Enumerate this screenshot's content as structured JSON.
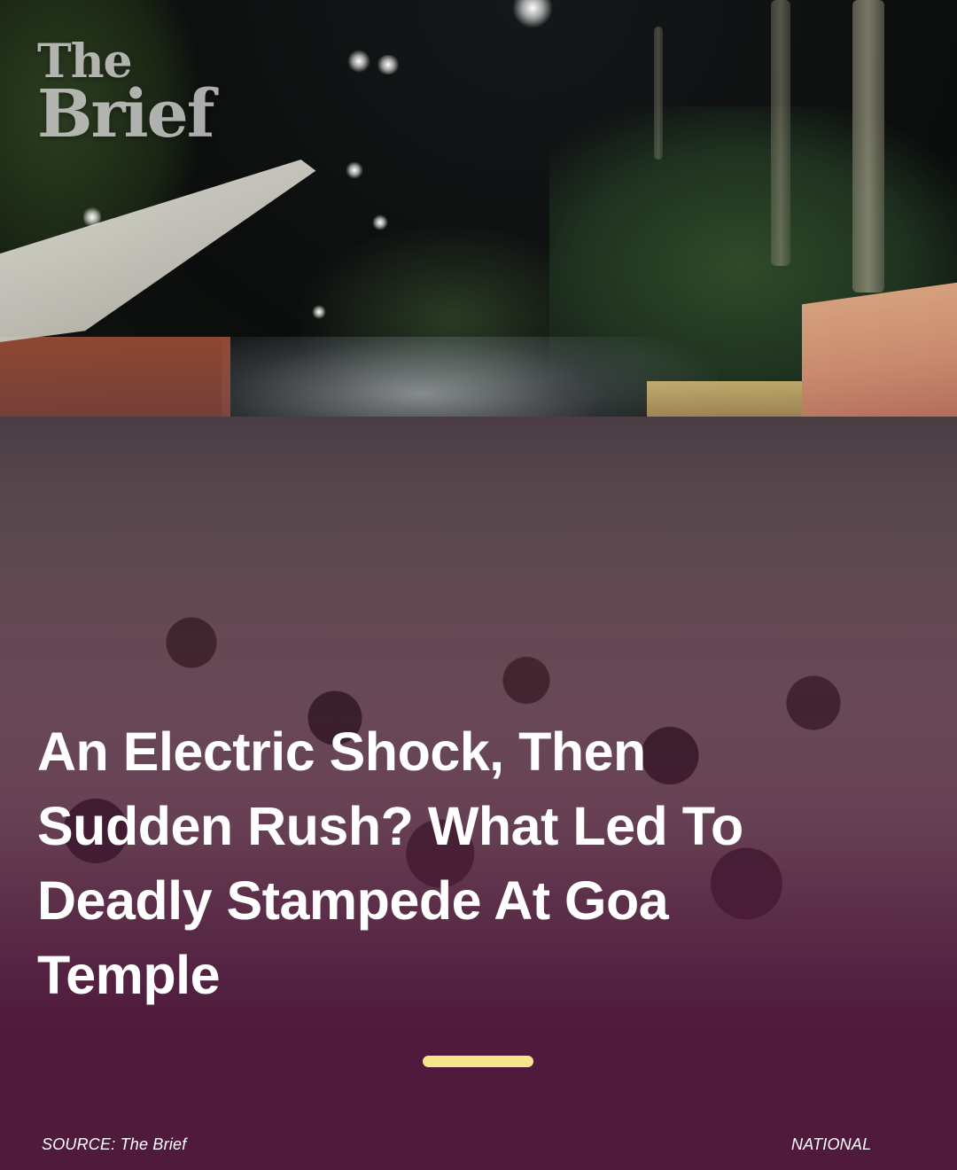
{
  "brand": {
    "line1": "The",
    "line2": "Brief"
  },
  "headline": {
    "lines": [
      "An Electric Shock, Then",
      "Sudden Rush? What Led To",
      "Deadly Stampede At Goa",
      "Temple"
    ]
  },
  "footer": {
    "source": "SOURCE: The Brief",
    "category": "NATIONAL"
  },
  "colors": {
    "overlay": "#4f1a3c",
    "accent_bar": "#f7e58c",
    "text": "#ffffff"
  },
  "image": {
    "description_icon": "crowd-photo"
  }
}
